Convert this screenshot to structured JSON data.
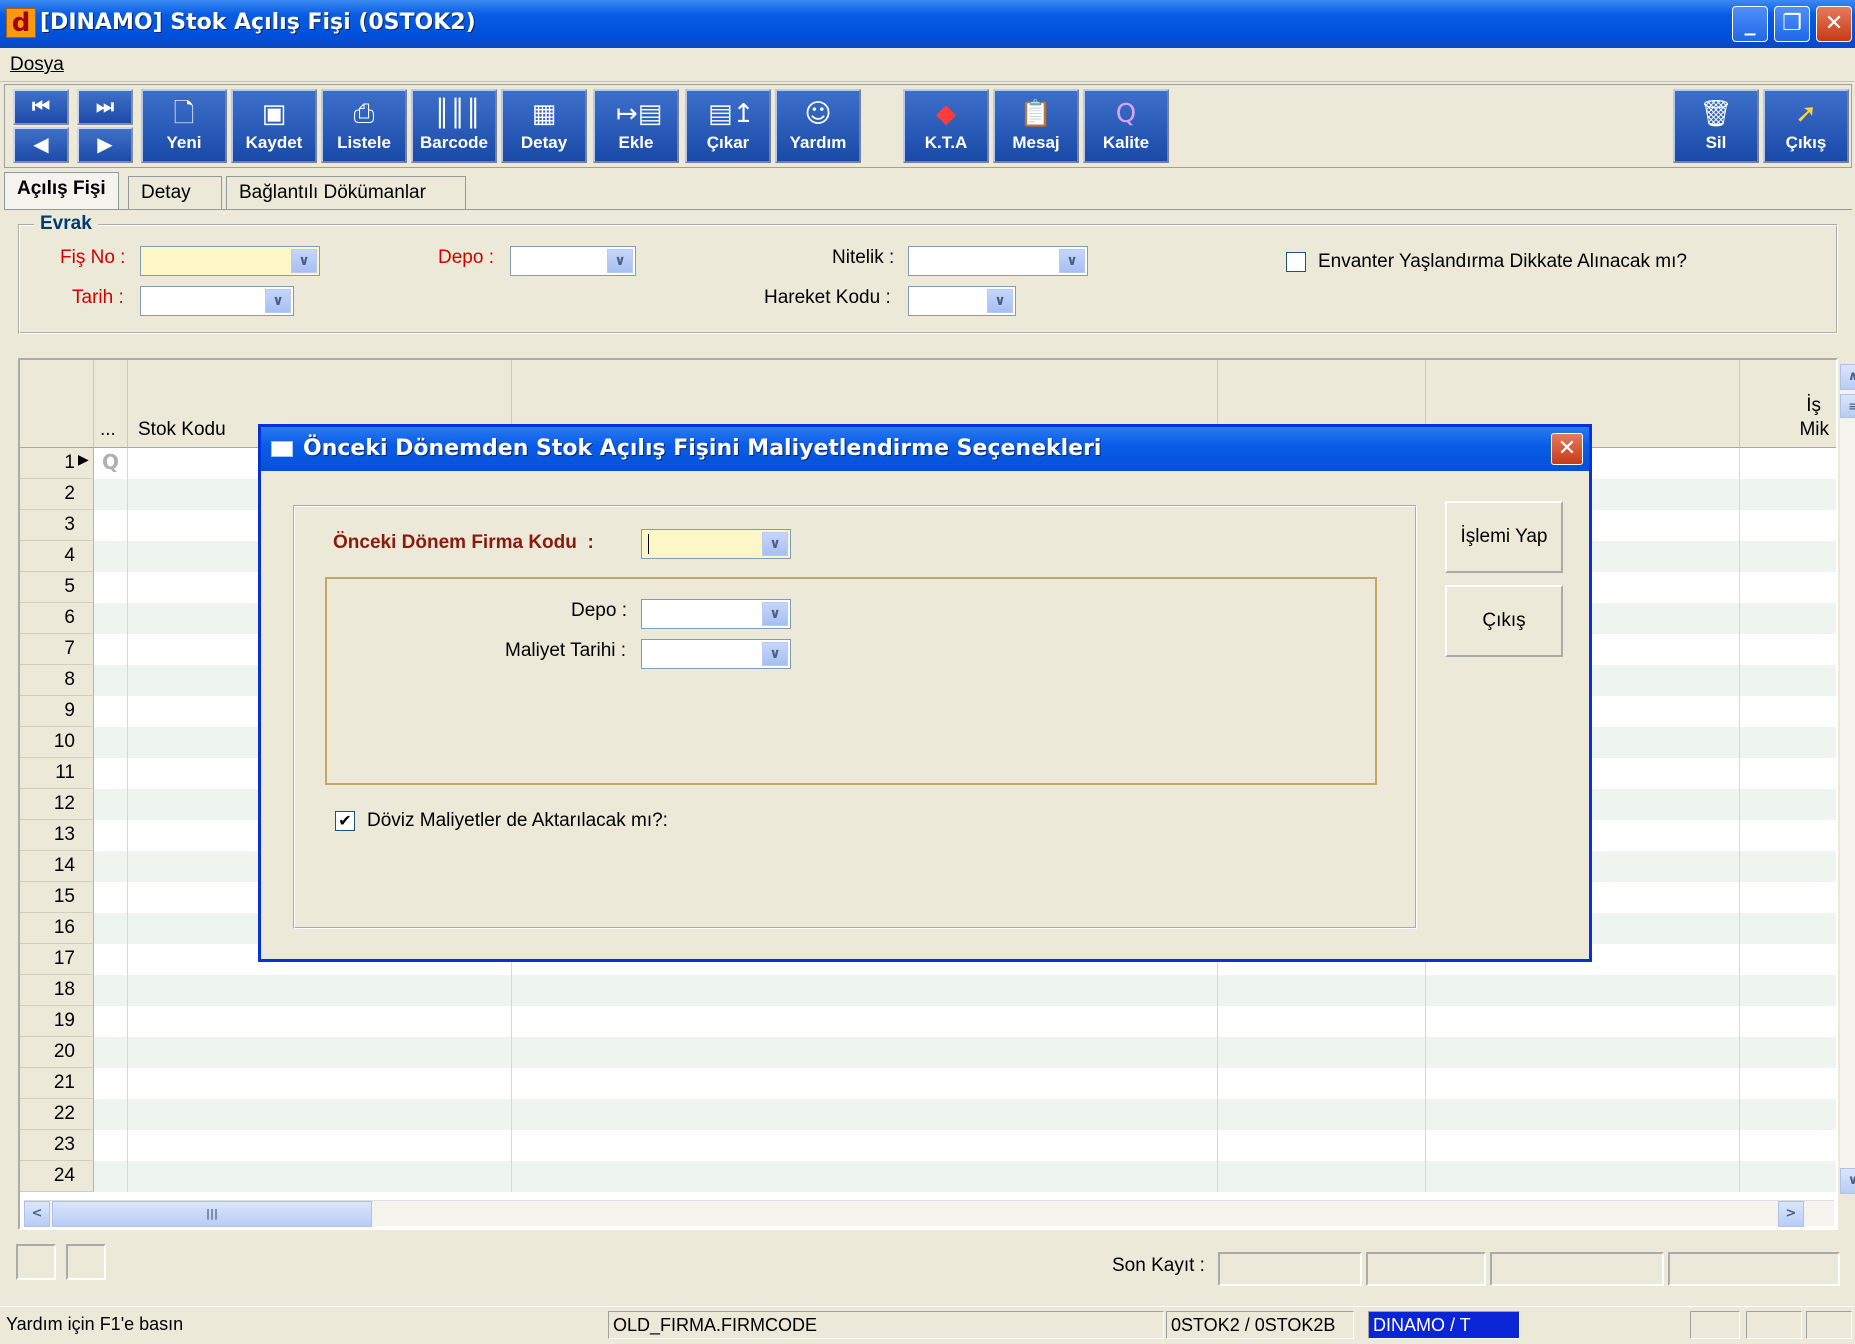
{
  "window": {
    "title": "[DINAMO] Stok Açılış Fişi (0STOK2)",
    "logo_letter": "d"
  },
  "menu": {
    "dosya": "Dosya"
  },
  "toolbar": {
    "yeni": "Yeni",
    "kaydet": "Kaydet",
    "listele": "Listele",
    "barcode": "Barcode",
    "detay": "Detay",
    "ekle": "Ekle",
    "cikar": "Çıkar",
    "yardim": "Yardım",
    "kta": "K.T.A",
    "mesaj": "Mesaj",
    "kalite": "Kalite",
    "sil": "Sil",
    "cikis": "Çıkış"
  },
  "tabs": [
    "Açılış Fişi",
    "Detay",
    "Bağlantılı Dökümanlar"
  ],
  "evrak": {
    "legend": "Evrak",
    "fis_no_label": "Fiş No :",
    "tarih_label": "Tarih :",
    "depo_label": "Depo :",
    "nitelik_label": "Nitelik :",
    "hareket_kodu_label": "Hareket Kodu :",
    "envanter_label": "Envanter Yaşlandırma Dikkate Alınacak mı?",
    "envanter_checked": false
  },
  "grid": {
    "col_dots": "...",
    "col_stok_kodu": "Stok Kodu",
    "col_partial_top": "İş",
    "col_partial_bottom": "Mik",
    "row_numbers": [
      "1",
      "2",
      "3",
      "4",
      "5",
      "6",
      "7",
      "8",
      "9",
      "10",
      "11",
      "12",
      "13",
      "14",
      "15",
      "16",
      "17",
      "18",
      "19",
      "20",
      "21",
      "22",
      "23",
      "24"
    ]
  },
  "bottom": {
    "son_kayit_label": "Son Kayıt :"
  },
  "statusbar": {
    "help": "Yardım için F1'e basın",
    "field": "OLD_FIRMA.FIRMCODE",
    "form": "0STOK2 / 0STOK2B",
    "db": "DINAMO / T"
  },
  "dialog": {
    "title": "Önceki Dönemden Stok Açılış Fişini Maliyetlendirme Seçenekleri",
    "firma_kodu_label": "Önceki Dönem Firma Kodu",
    "colon": ":",
    "depo_label": "Depo :",
    "maliyet_tarihi_label": "Maliyet Tarihi :",
    "doviz_label": "Döviz Maliyetler de Aktarılacak mı?:",
    "doviz_checked": true,
    "btn_islemi_yap": "İşlemi Yap",
    "btn_cikis": "Çıkış"
  }
}
